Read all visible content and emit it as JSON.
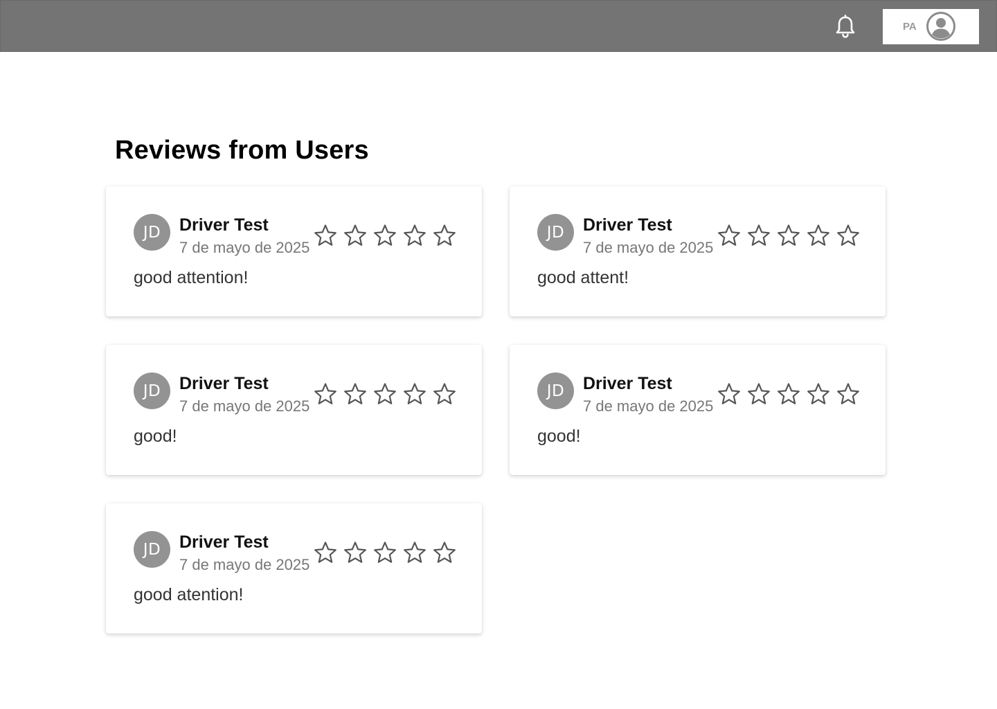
{
  "header": {
    "user_initials": "PA",
    "bell_icon": "bell-icon",
    "user_icon": "user-circle-icon"
  },
  "page": {
    "title": "Reviews from Users"
  },
  "colors": {
    "topbar": "#747474",
    "avatar": "#939393",
    "star_outline": "#555555"
  },
  "reviews": [
    {
      "initials": "JD",
      "name": "Driver Test",
      "date": "7 de mayo de 2025",
      "rating": 0,
      "max_rating": 5,
      "comment": "good attention!"
    },
    {
      "initials": "JD",
      "name": "Driver Test",
      "date": "7 de mayo de 2025",
      "rating": 0,
      "max_rating": 5,
      "comment": "good attent!"
    },
    {
      "initials": "JD",
      "name": "Driver Test",
      "date": "7 de mayo de 2025",
      "rating": 0,
      "max_rating": 5,
      "comment": "good!"
    },
    {
      "initials": "JD",
      "name": "Driver Test",
      "date": "7 de mayo de 2025",
      "rating": 0,
      "max_rating": 5,
      "comment": "good!"
    },
    {
      "initials": "JD",
      "name": "Driver Test",
      "date": "7 de mayo de 2025",
      "rating": 0,
      "max_rating": 5,
      "comment": "good atention!"
    }
  ]
}
